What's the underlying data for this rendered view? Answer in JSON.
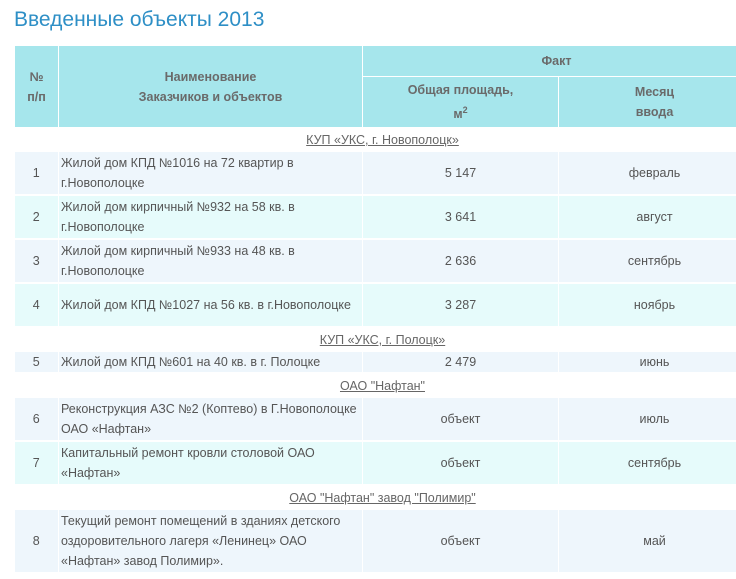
{
  "title": "Введенные объекты 2013",
  "headers": {
    "num": "№\nп/п",
    "name": "Наименование\nЗаказчиков и объектов",
    "fact": "Факт",
    "area": "Общая площадь,\nм",
    "area_sup": "2",
    "month": "Месяц\nввода"
  },
  "groups": [
    {
      "name": "КУП «УКС, г. Новополоцк»",
      "rows": [
        {
          "num": "1",
          "name": "Жилой дом КПД №1016 на 72 квартир в г.Новополоцке",
          "area": "5 147",
          "month": "февраль"
        },
        {
          "num": "2",
          "name": "Жилой дом кирпичный №932 на 58 кв. в г.Новополоцке",
          "area": "3 641",
          "month": "август"
        },
        {
          "num": "3",
          "name": "Жилой дом кирпичный №933 на 48 кв. в г.Новополоцке",
          "area": "2 636",
          "month": "сентябрь"
        },
        {
          "num": "4",
          "name": "Жилой дом КПД №1027 на 56 кв. в г.Новополоцке",
          "area": "3 287",
          "month": "ноябрь"
        }
      ]
    },
    {
      "name": "КУП «УКС, г. Полоцк»",
      "rows": [
        {
          "num": "5",
          "name": "Жилой дом КПД №601 на 40 кв. в г. Полоцке",
          "area": "2 479",
          "month": "июнь"
        }
      ]
    },
    {
      "name": "ОАО \"Нафтан\"",
      "rows": [
        {
          "num": "6",
          "name": "Реконструкция АЗС №2 (Коптево) в Г.Новополоцке ОАО «Нафтан»",
          "area": "объект",
          "month": "июль"
        },
        {
          "num": "7",
          "name": "Капитальный ремонт кровли столовой ОАО «Нафтан»",
          "area": "объект",
          "month": "сентябрь"
        }
      ]
    },
    {
      "name": "ОАО \"Нафтан\" завод \"Полимир\"",
      "rows": [
        {
          "num": "8",
          "name": "Текущий ремонт помещений в зданиях детского оздоровительного лагеря «Ленинец» ОАО «Нафтан» завод Полимир».",
          "area": "объект",
          "month": "май"
        }
      ]
    }
  ]
}
